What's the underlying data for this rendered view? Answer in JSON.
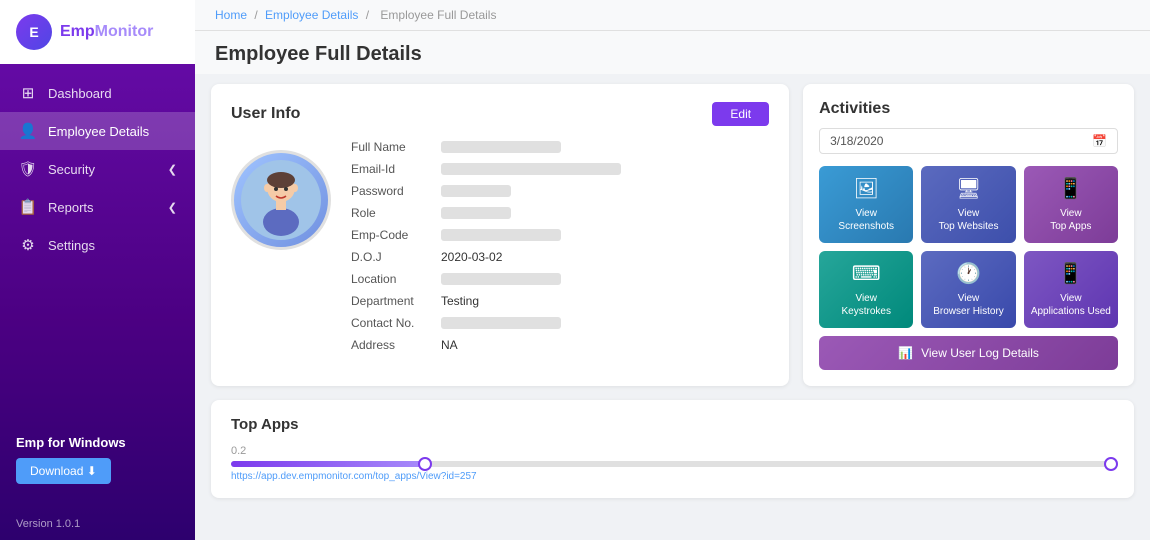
{
  "app": {
    "name": "EmpMonitor",
    "logo_text": "Emp",
    "logo_highlight": "Monitor",
    "version": "Version 1.0.1"
  },
  "breadcrumb": {
    "home": "Home",
    "employee_details": "Employee Details",
    "current": "Employee Full Details",
    "sep": "/"
  },
  "page": {
    "title": "Employee Full Details"
  },
  "sidebar": {
    "items": [
      {
        "id": "dashboard",
        "label": "Dashboard",
        "icon": "⊞"
      },
      {
        "id": "employee-details",
        "label": "Employee Details",
        "icon": "👤",
        "active": true
      },
      {
        "id": "security",
        "label": "Security",
        "icon": "🛡",
        "has_chevron": true
      },
      {
        "id": "reports",
        "label": "Reports",
        "icon": "📋",
        "has_chevron": true
      },
      {
        "id": "settings",
        "label": "Settings",
        "icon": "⚙"
      }
    ],
    "download_section": {
      "title": "Emp for Windows",
      "button_label": "Download ⬇"
    }
  },
  "user_info": {
    "section_title": "User Info",
    "edit_button": "Edit",
    "fields": [
      {
        "label": "Full Name",
        "value": "",
        "type": "blur"
      },
      {
        "label": "Email-Id",
        "value": "",
        "type": "blur-long"
      },
      {
        "label": "Password",
        "value": "",
        "type": "blur-short"
      },
      {
        "label": "Role",
        "value": "",
        "type": "blur-short"
      },
      {
        "label": "Emp-Code",
        "value": "",
        "type": "blur"
      },
      {
        "label": "D.O.J",
        "value": "2020-03-02",
        "type": "text"
      },
      {
        "label": "Location",
        "value": "",
        "type": "blur"
      },
      {
        "label": "Department",
        "value": "Testing",
        "type": "text"
      },
      {
        "label": "Contact No.",
        "value": "",
        "type": "blur"
      },
      {
        "label": "Address",
        "value": "NA",
        "type": "text"
      }
    ]
  },
  "activities": {
    "section_title": "Activities",
    "date": "3/18/2020",
    "buttons": [
      {
        "id": "screenshots",
        "label": "View\nScreenshots",
        "icon": "🖼",
        "color": "btn-blue"
      },
      {
        "id": "top-websites",
        "label": "View\nTop Websites",
        "icon": "🖥",
        "color": "btn-indigo"
      },
      {
        "id": "top-apps",
        "label": "View\nTop Apps",
        "icon": "📱",
        "color": "btn-purple"
      },
      {
        "id": "keystrokes",
        "label": "View\nKeystrokes",
        "icon": "⌨",
        "color": "btn-teal"
      },
      {
        "id": "browser-history",
        "label": "View\nBrowser History",
        "icon": "🕐",
        "color": "btn-darkblue"
      },
      {
        "id": "applications-used",
        "label": "View\nApplications Used",
        "icon": "📱",
        "color": "btn-lightpurple"
      }
    ],
    "log_button": "View User Log Details"
  },
  "top_apps": {
    "section_title": "Top Apps",
    "slider_value": "0.2",
    "url": "https://app.dev.empmonitor.com/top_apps/View?id=257"
  }
}
